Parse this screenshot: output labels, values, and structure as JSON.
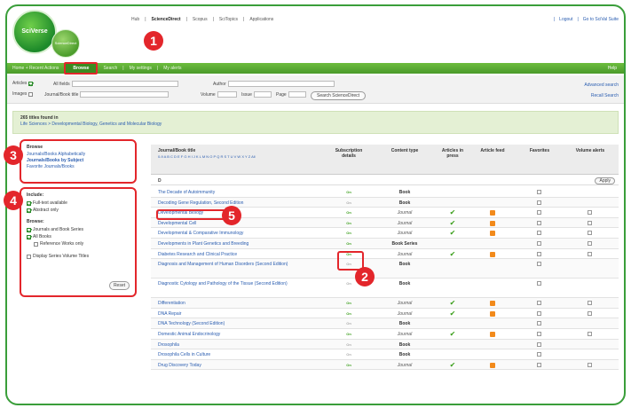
{
  "brand": {
    "logo_main": "SciVerse",
    "logo_sub": "ScienceDirect"
  },
  "topnav": [
    "Hub",
    "ScienceDirect",
    "Scopus",
    "SciTopics",
    "Applications"
  ],
  "toplinks": [
    "Logout",
    "Go to SciVal Suite"
  ],
  "greenbar": {
    "left": "Home + Recent Actions",
    "active": "Browse",
    "items": [
      "Search",
      "My settings",
      "My alerts"
    ],
    "help": "Help"
  },
  "search": {
    "row1": [
      "Articles",
      "All fields",
      "Author"
    ],
    "row2": [
      "Images",
      "Journal/Book title",
      "Volume",
      "Issue",
      "Page"
    ],
    "button": "Search ScienceDirect",
    "advanced": "Advanced search",
    "recall": "Recall Search"
  },
  "results": {
    "title": "265 titles found in",
    "path": "Life Sciences > Developmental Biology, Genetics and Molecular Biology"
  },
  "browse": {
    "heading": "Browse",
    "links": [
      "Journals/Books Alphabetically",
      "Journals/Books by Subject",
      "Favorite Journals/Books"
    ]
  },
  "filters": {
    "include_label": "Include:",
    "include": [
      {
        "label": "Full-text available",
        "checked": true
      },
      {
        "label": "Abstract only",
        "checked": true
      }
    ],
    "browse_label": "Browse:",
    "browse": [
      {
        "label": "Journals and Book Series",
        "checked": true
      },
      {
        "label": "All Books",
        "checked": true
      },
      {
        "label": "Reference Works only",
        "checked": false
      }
    ],
    "series": {
      "label": "Display Series Volume Titles",
      "checked": false
    },
    "reset": "Reset"
  },
  "table": {
    "headers": {
      "title": "Journal/Book title",
      "subscription": "Subscription details",
      "content": "Content type",
      "press": "Articles in press",
      "feed": "Article feed",
      "favorites": "Favorites",
      "alerts": "Volume alerts"
    },
    "alphabet": "0-9 A B C D E F G H I J K L M N O P Q R S T U V W X Y Z All",
    "group": "D",
    "apply": "Apply",
    "rows": [
      {
        "title": "The Decade of Autoimmunity",
        "sub": "on",
        "type": "Book",
        "press": false,
        "feed": false,
        "alert": false,
        "tall": false
      },
      {
        "title": "Decoding Gene Regulation, Second Edition",
        "sub": "off",
        "type": "Book",
        "press": false,
        "feed": false,
        "alert": false,
        "tall": false
      },
      {
        "title": "Developmental Biology",
        "sub": "on",
        "type": "Journal",
        "press": true,
        "feed": true,
        "alert": true,
        "tall": false
      },
      {
        "title": "Developmental Cell",
        "sub": "on",
        "type": "Journal",
        "press": true,
        "feed": true,
        "alert": true,
        "tall": false
      },
      {
        "title": "Developmental & Comparative Immunology",
        "sub": "on",
        "type": "Journal",
        "press": true,
        "feed": true,
        "alert": true,
        "tall": false
      },
      {
        "title": "Developments in Plant Genetics and Breeding",
        "sub": "on",
        "type": "Book Series",
        "press": false,
        "feed": false,
        "alert": true,
        "tall": false
      },
      {
        "title": "Diabetes Research and Clinical Practice",
        "sub": "on",
        "type": "Journal",
        "press": true,
        "feed": true,
        "alert": true,
        "tall": false
      },
      {
        "title": "Diagnosis and Management of Human Disorders (Second Edition)",
        "sub": "off",
        "type": "Book",
        "press": false,
        "feed": false,
        "alert": false,
        "tall": true
      },
      {
        "title": "Diagnostic Cytology and Pathology of the Tissue (Second Edition)",
        "sub": "off",
        "type": "Book",
        "press": false,
        "feed": false,
        "alert": false,
        "tall": true
      },
      {
        "title": "Differentiation",
        "sub": "on",
        "type": "Journal",
        "press": true,
        "feed": true,
        "alert": true,
        "tall": false
      },
      {
        "title": "DNA Repair",
        "sub": "on",
        "type": "Journal",
        "press": true,
        "feed": true,
        "alert": true,
        "tall": false
      },
      {
        "title": "DNA Technology (Second Edition)",
        "sub": "off",
        "type": "Book",
        "press": false,
        "feed": false,
        "alert": false,
        "tall": false
      },
      {
        "title": "Domestic Animal Endocrinology",
        "sub": "on",
        "type": "Journal",
        "press": true,
        "feed": true,
        "alert": true,
        "tall": false
      },
      {
        "title": "Drosophila",
        "sub": "off",
        "type": "Book",
        "press": false,
        "feed": false,
        "alert": false,
        "tall": false
      },
      {
        "title": "Drosophila Cells in Culture",
        "sub": "off",
        "type": "Book",
        "press": false,
        "feed": false,
        "alert": false,
        "tall": false
      },
      {
        "title": "Drug Discovery Today",
        "sub": "on",
        "type": "Journal",
        "press": true,
        "feed": true,
        "alert": true,
        "tall": false
      }
    ],
    "sub_label": "On"
  },
  "markers": [
    "1",
    "2",
    "3",
    "4",
    "5"
  ],
  "colors": {
    "accent_red": "#e3262b",
    "brand_green": "#4a9a2a",
    "link_blue": "#2a5db0",
    "feed_orange": "#f28a1b"
  }
}
